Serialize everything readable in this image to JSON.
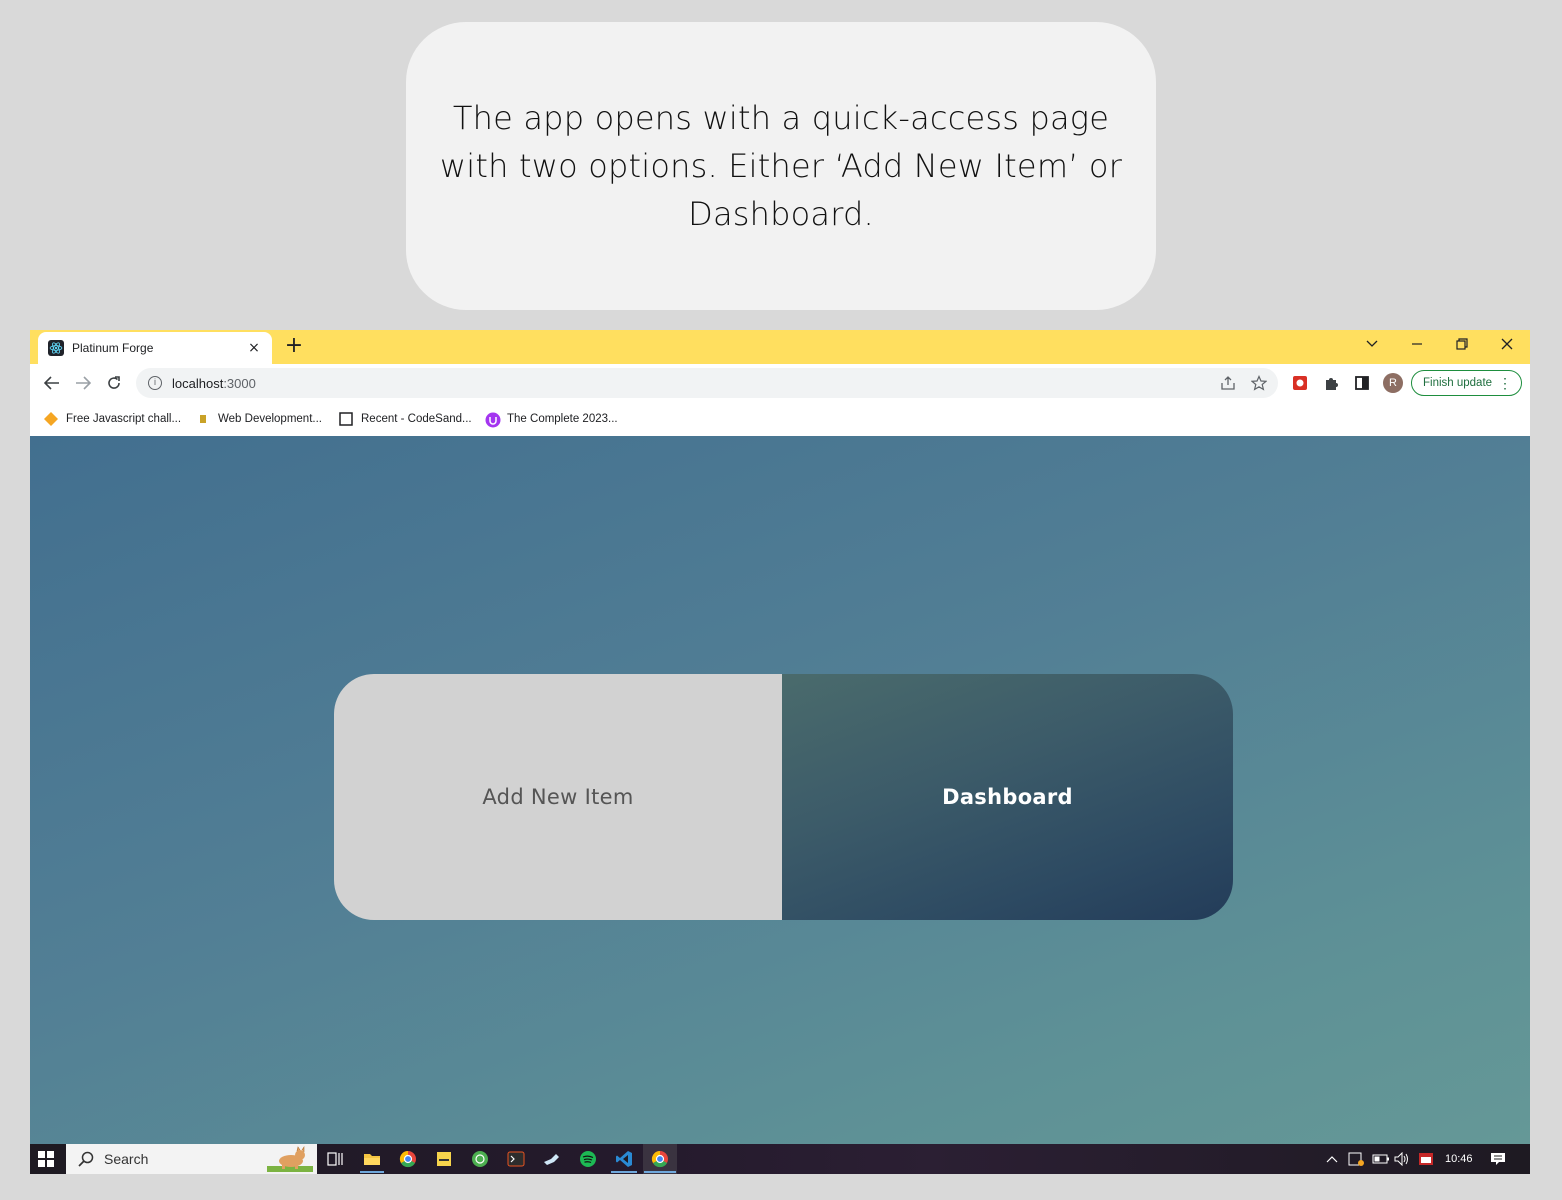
{
  "caption": {
    "text": "The app opens with a quick-access page with two options. Either ‘Add New Item’ or Dashboard."
  },
  "browser": {
    "tab_title": "Platinum Forge",
    "tab_close": "×",
    "new_tab": "+",
    "url_host": "localhost",
    "url_port": ":3000",
    "finish_update_label": "Finish update",
    "avatar_letter": "R",
    "bookmarks": [
      {
        "label": "Free Javascript chall...",
        "icon": "diamond-icon",
        "color": "#f5a623"
      },
      {
        "label": "Web Development...",
        "icon": "bookmark-favicon",
        "color": "#c9a227"
      },
      {
        "label": "Recent - CodeSand...",
        "icon": "codesandbox-icon",
        "color": "#202124"
      },
      {
        "label": "The Complete 2023...",
        "icon": "udemy-icon",
        "color": "#a435f0"
      }
    ]
  },
  "app": {
    "add_new_item_label": "Add New Item",
    "dashboard_label": "Dashboard"
  },
  "taskbar": {
    "search_label": "Search",
    "clock": "10:46",
    "apps": [
      {
        "name": "task-view-icon",
        "color": "#ffffff"
      },
      {
        "name": "file-explorer-icon",
        "color": "#f4c542"
      },
      {
        "name": "chrome-icon",
        "color": "#e8453c"
      },
      {
        "name": "sticky-notes-icon",
        "color": "#f7d44c"
      },
      {
        "name": "xbox-icon",
        "color": "#4caf50"
      },
      {
        "name": "terminal-icon",
        "color": "#2d2d2d"
      },
      {
        "name": "steam-icon",
        "color": "#1b75bb"
      },
      {
        "name": "spotify-icon",
        "color": "#1db954"
      },
      {
        "name": "vscode-icon",
        "color": "#2a8ad4"
      },
      {
        "name": "chrome-active-icon",
        "color": "#e8453c"
      }
    ]
  },
  "colors": {
    "tabbar": "#ffdf5f",
    "page_gradient_start": "#426f8f",
    "page_gradient_end": "#659897",
    "add_button_bg": "#d2d2d2",
    "dashboard_bg": "#2d4a62"
  }
}
